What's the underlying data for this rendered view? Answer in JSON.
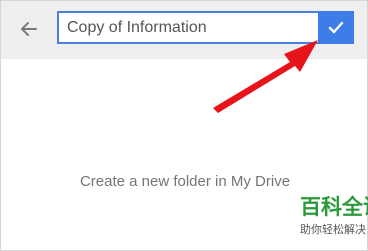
{
  "header": {
    "back_icon": "arrow-left-icon",
    "folder_name_value": "Copy of Information",
    "confirm_icon": "checkmark-icon",
    "accent_color": "#3d7de8"
  },
  "main": {
    "empty_message": "Create a new folder in My Drive"
  },
  "annotation": {
    "arrow_color": "#e8141b"
  },
  "watermark": {
    "title": "百科全说",
    "subtitle": "助你轻松解决"
  }
}
